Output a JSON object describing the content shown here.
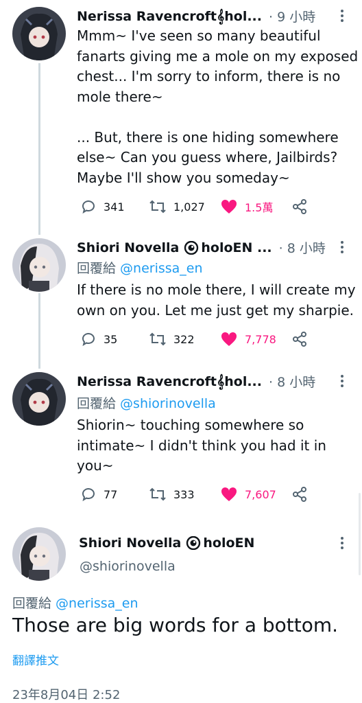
{
  "tweets": [
    {
      "name": "Nerissa Ravencroft𝄞hol...",
      "time": "· 9 小時",
      "reply_prefix": "",
      "reply_handle": "",
      "text": "Mmm~ I've seen so many beautiful\nfanarts giving me a mole on my exposed\nchest... I'm sorry to inform, there is no\nmole there~\n\n... But, there is one hiding somewhere\nelse~ Can you guess where, Jailbirds?\nMaybe I'll show you someday~",
      "replies": "341",
      "retweets": "1,027",
      "likes": "1.5萬"
    },
    {
      "name": "Shiori Novella",
      "name_suffix": "holoEN ...",
      "time": "· 8 小時",
      "reply_prefix": "回覆給 ",
      "reply_handle": "@nerissa_en",
      "text": "If there is no mole there, I will create my\nown on you. Let me just get my sharpie.",
      "replies": "35",
      "retweets": "322",
      "likes": "7,778"
    },
    {
      "name": "Nerissa Ravencroft𝄞hol...",
      "time": "· 8 小時",
      "reply_prefix": "回覆給 ",
      "reply_handle": "@shiorinovella",
      "text": "Shiorin~ touching somewhere so\nintimate~ I didn't think you had it in\nyou~",
      "replies": "77",
      "retweets": "333",
      "likes": "7,607"
    }
  ],
  "main_tweet": {
    "name": "Shiori Novella",
    "name_suffix": "holoEN",
    "handle": "@shiorinovella",
    "reply_prefix": "回覆給 ",
    "reply_handle": "@nerissa_en",
    "text": "Those are big words for a bottom.",
    "translate": "翻譯推文",
    "timestamp": "23年8月04日 2:52"
  },
  "colors": {
    "accent": "#1d9bf0",
    "like": "#f91880",
    "secondary": "#536471",
    "thread_line": "#cfd9de"
  },
  "icons": [
    "reply-icon",
    "retweet-icon",
    "heart-icon",
    "share-icon",
    "more-icon",
    "eye-icon"
  ]
}
